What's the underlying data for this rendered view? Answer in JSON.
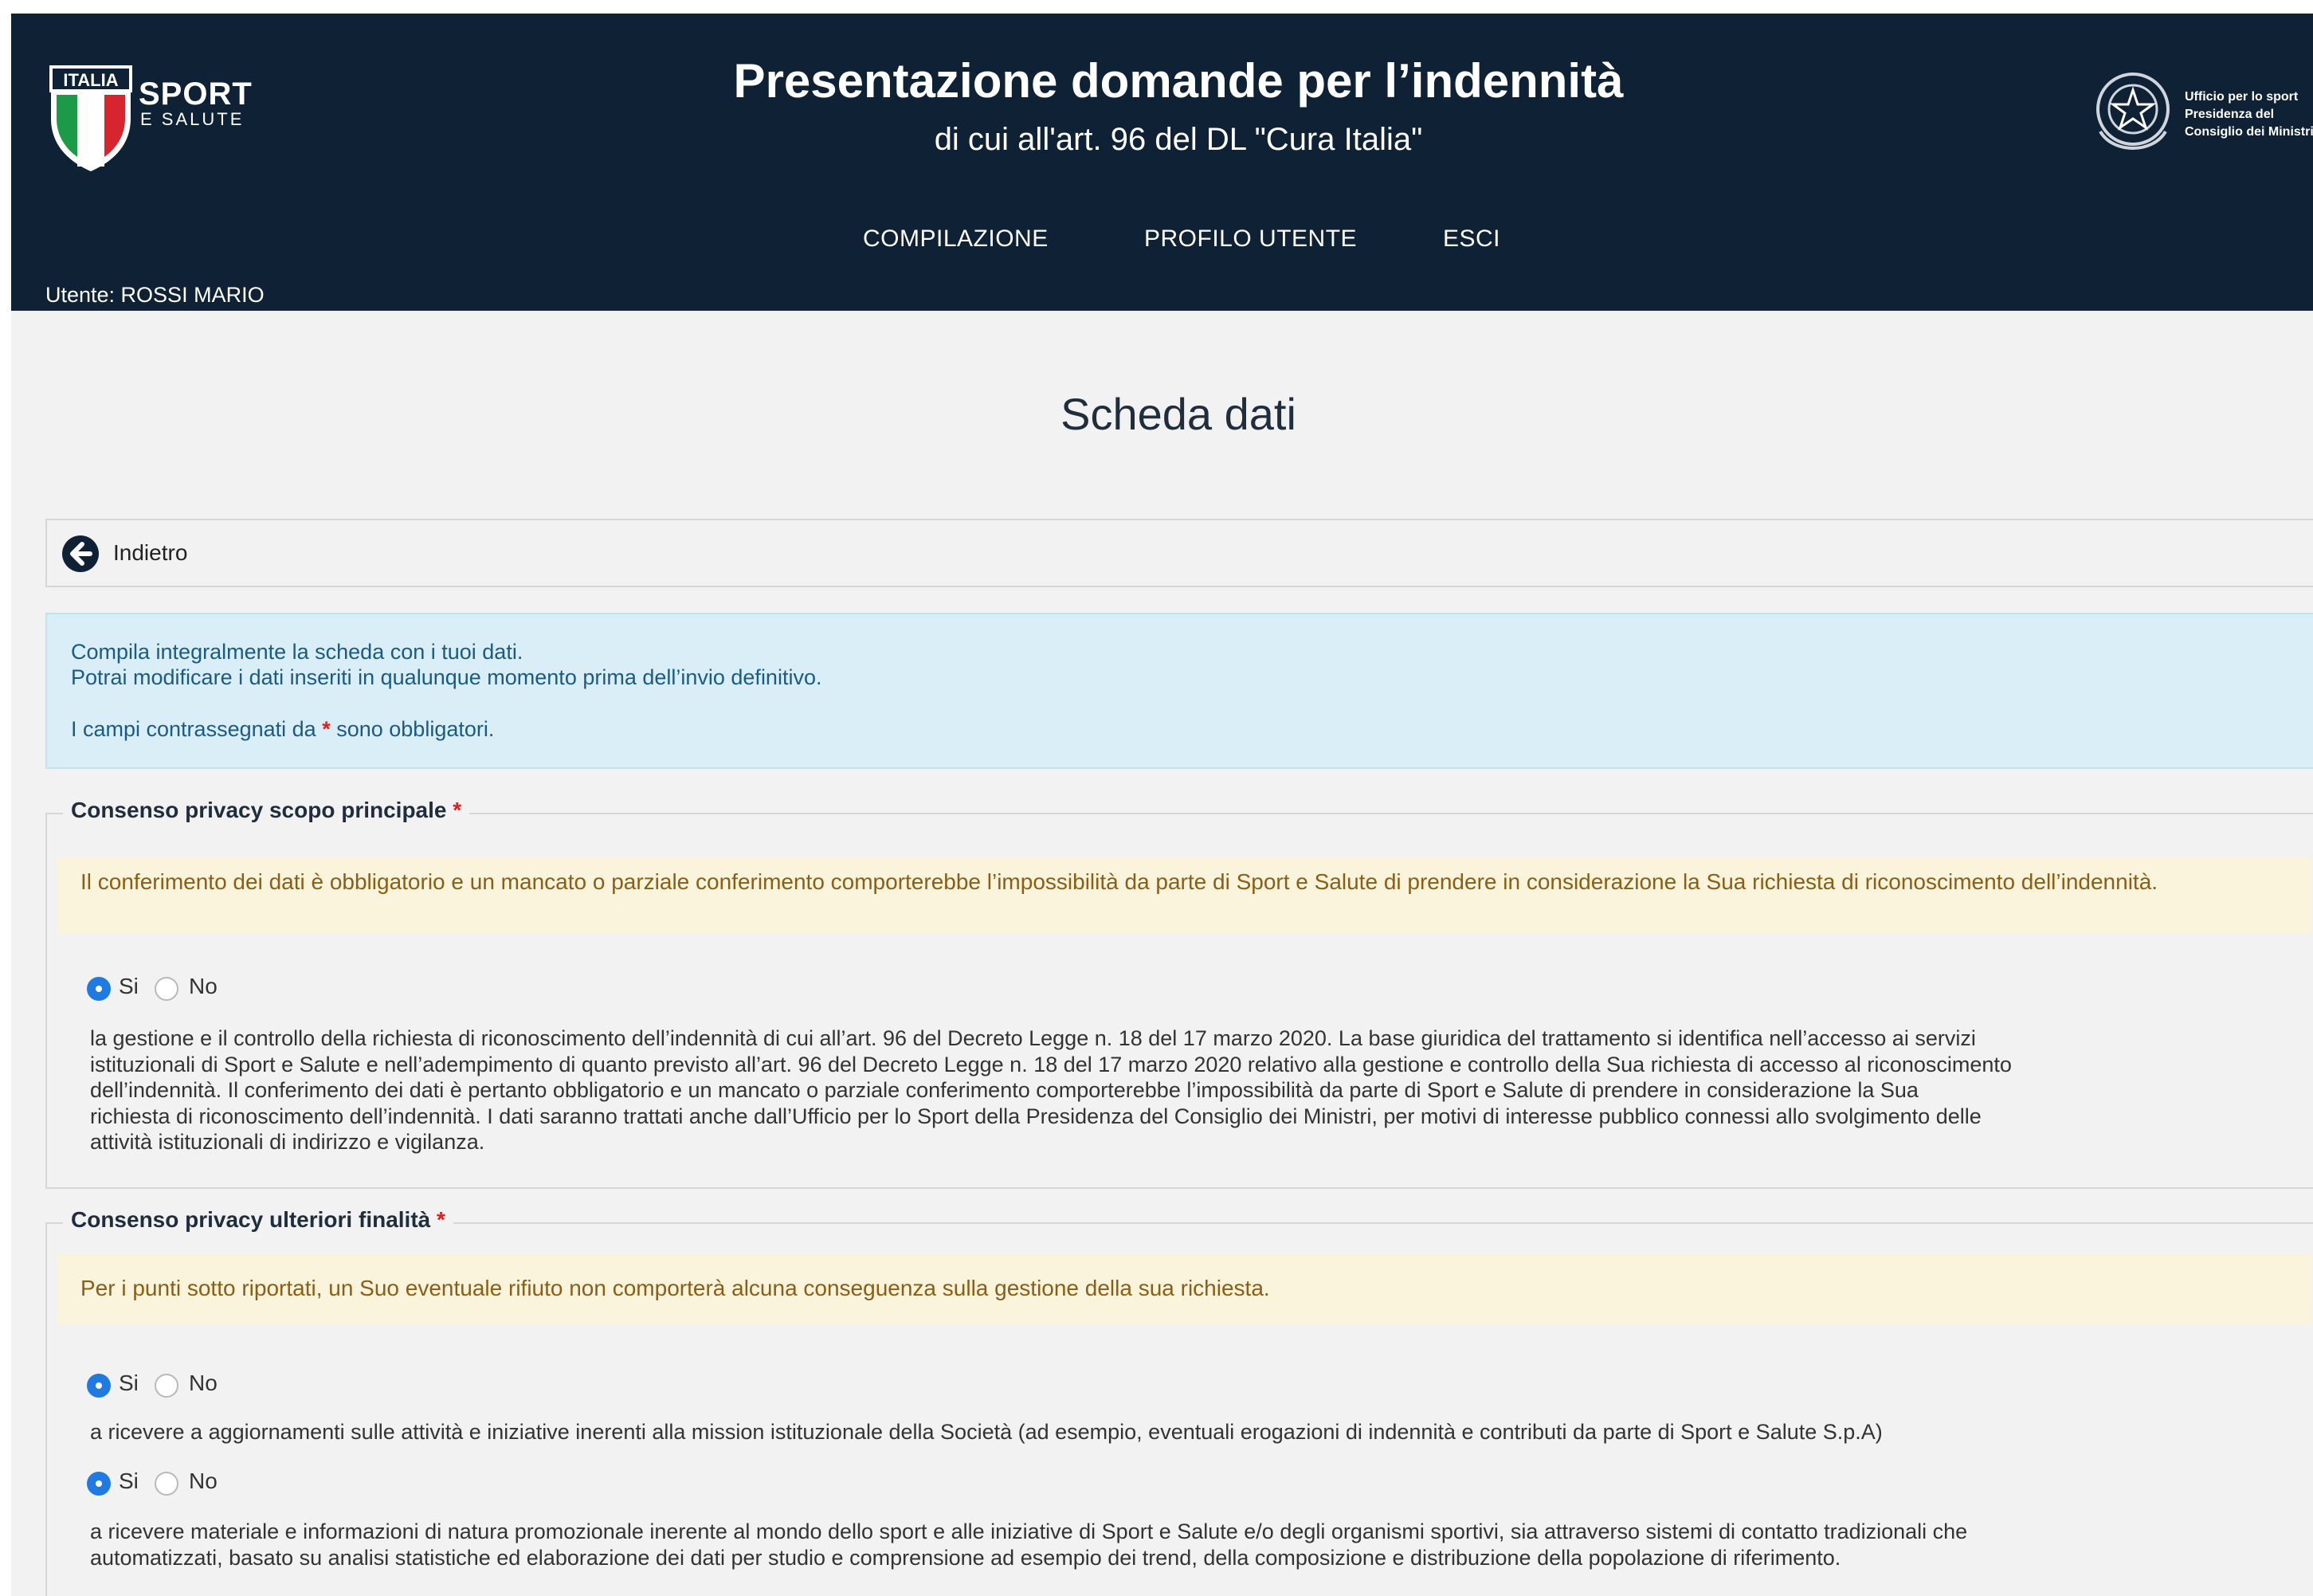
{
  "header": {
    "logo": {
      "line1": "ITALIA",
      "line2": "SPORT",
      "line3": "E SALUTE"
    },
    "title": "Presentazione domande per l’indennità",
    "subtitle": "di cui all'art. 96 del DL \"Cura Italia\"",
    "emblem_text": [
      "Ufficio per lo sport",
      "Presidenza del",
      "Consiglio dei Ministri"
    ],
    "nav": [
      "COMPILAZIONE",
      "PROFILO UTENTE",
      "ESCI"
    ],
    "user": "Utente: ROSSI MARIO"
  },
  "page": {
    "title": "Scheda dati",
    "back_label": "Indietro"
  },
  "info": {
    "line1": "Compila integralmente la scheda con i tuoi dati.",
    "line2": "Potrai modificare i dati inseriti in qualunque momento prima dell’invio definitivo.",
    "line3_pre": "I campi contrassegnati da",
    "line3_mark": "*",
    "line3_post": "sono obbligatori."
  },
  "section1": {
    "legend": "Consenso privacy scopo principale",
    "required_mark": "*",
    "warning": "Il conferimento dei dati è obbligatorio e un mancato o parziale conferimento comporterebbe l’impossibilità da parte di Sport e Salute di prendere in considerazione la Sua richiesta di riconoscimento dell’indennità.",
    "radio": {
      "yes": "Si",
      "no": "No",
      "selected": "Si"
    },
    "text_lines": [
      "la gestione e il controllo della richiesta di riconoscimento dell’indennità di cui all’art. 96 del Decreto Legge n. 18 del 17 marzo 2020. La base giuridica del trattamento si identifica nell’accesso ai servizi",
      "istituzionali di Sport e Salute e nell’adempimento di quanto previsto all’art. 96 del Decreto Legge n. 18 del 17 marzo 2020 relativo alla gestione e controllo della Sua richiesta di accesso al riconoscimento",
      "dell’indennità. Il conferimento dei dati è pertanto obbligatorio e un mancato o parziale conferimento comporterebbe l’impossibilità da parte di Sport e Salute di prendere in considerazione la Sua",
      "richiesta di riconoscimento dell’indennità. I dati saranno trattati anche dall’Ufficio per lo Sport della Presidenza del Consiglio dei Ministri, per motivi di interesse pubblico connessi allo svolgimento delle",
      "attività istituzionali di indirizzo e vigilanza."
    ]
  },
  "section2": {
    "legend": "Consenso privacy ulteriori finalità",
    "required_mark": "*",
    "warning": "Per i punti sotto riportati, un Suo eventuale rifiuto non comporterà alcuna conseguenza sulla gestione della sua richiesta.",
    "radio_a": {
      "yes": "Si",
      "no": "No",
      "selected": "Si"
    },
    "text_a": "a ricevere a aggiornamenti sulle attività e iniziative inerenti alla mission istituzionale della Società (ad esempio, eventuali erogazioni di indennità e contributi da parte di Sport e Salute S.p.A)",
    "radio_b": {
      "yes": "Si",
      "no": "No",
      "selected": "Si"
    },
    "text_b_lines": [
      "a ricevere materiale e informazioni di natura promozionale inerente al mondo dello sport e alle iniziative di Sport e Salute e/o degli organismi sportivi, sia attraverso sistemi di contatto tradizionali che",
      "automatizzati, basato su analisi statistiche ed elaborazione dei dati per studio e comprensione ad esempio dei trend, della composizione e distribuzione della popolazione di riferimento."
    ]
  },
  "colors": {
    "header_bg": "#0f2135",
    "radio_checked": "#1f7be2",
    "info_bg": "#d9eef6",
    "warning_bg": "#fbf4dd",
    "required": "#e0201e"
  }
}
